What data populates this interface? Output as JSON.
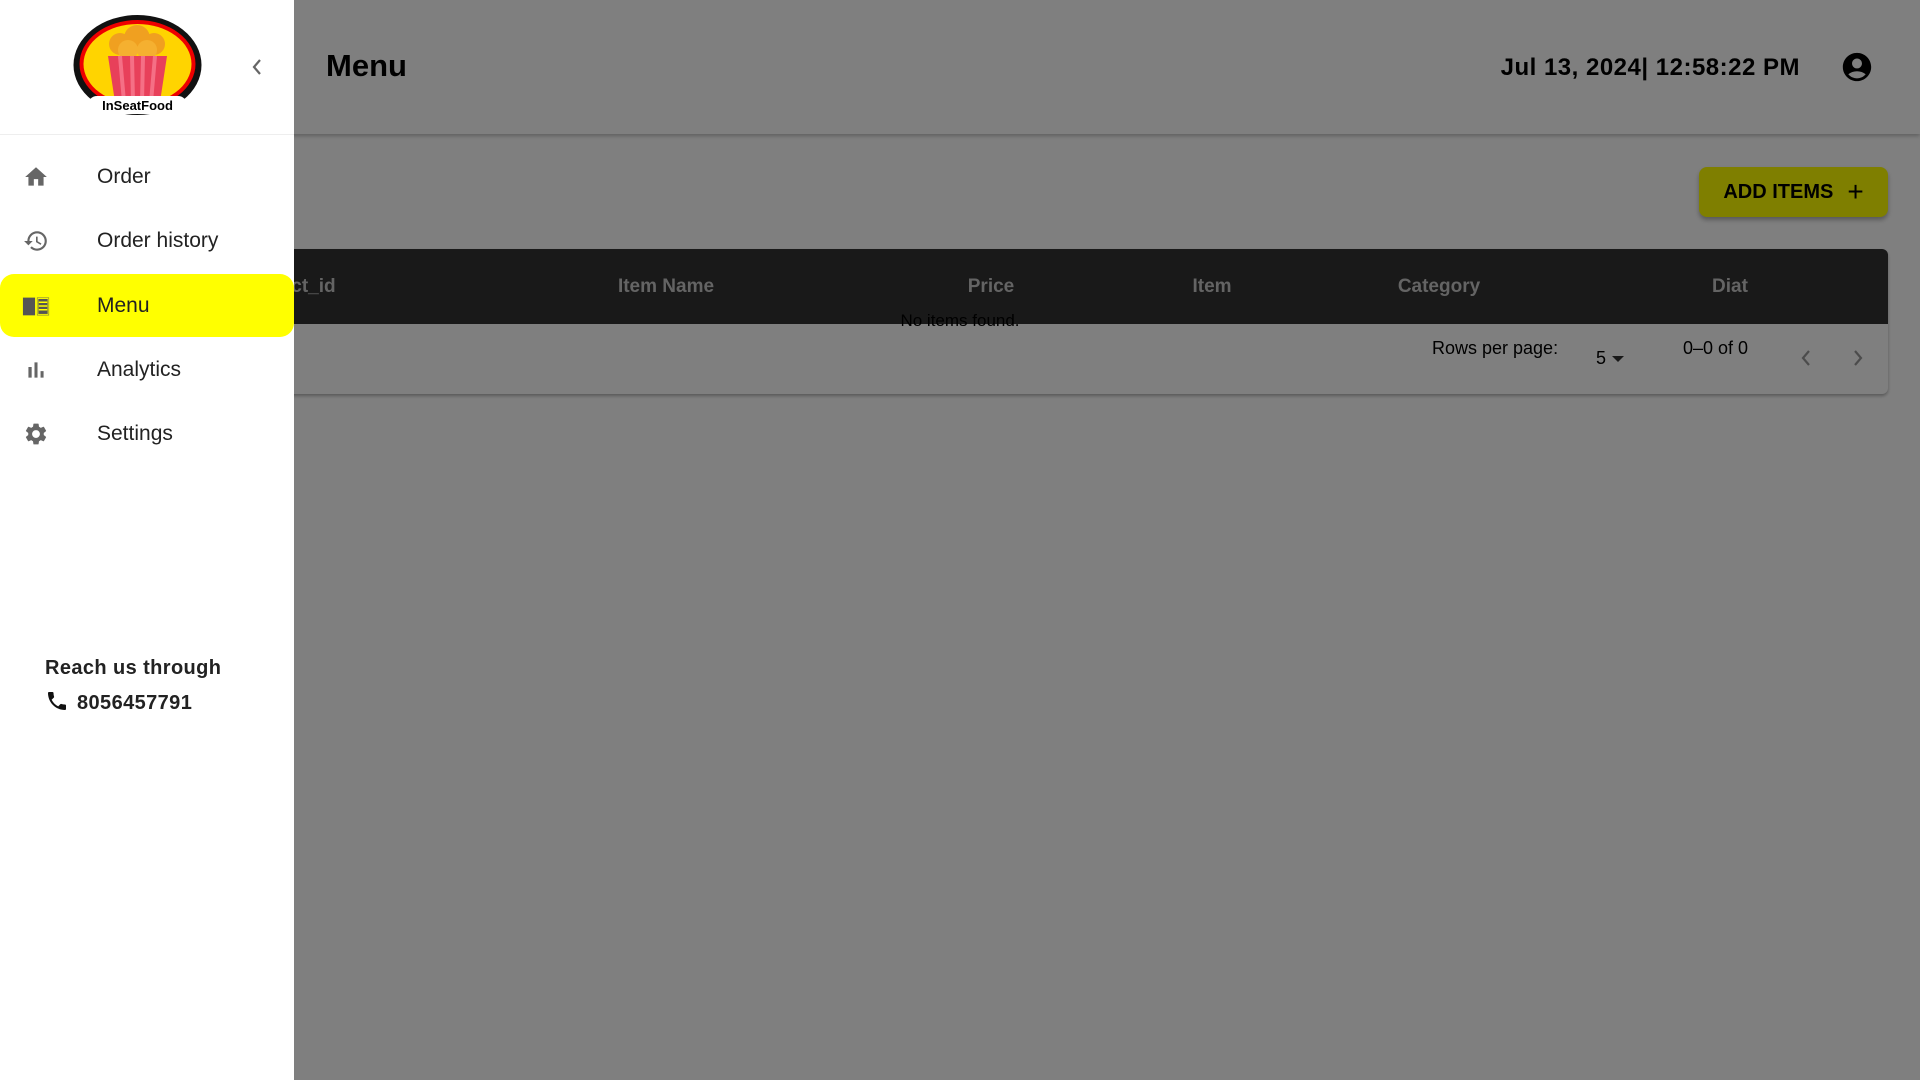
{
  "header": {
    "title": "Menu",
    "datetime": "Jul 13, 2024| 12:58:22 PM",
    "avatar_icon": "account-circle-icon"
  },
  "toolbar": {
    "add_items_label": "ADD ITEMS",
    "add_icon": "plus-icon"
  },
  "table": {
    "columns": [
      "Product_id",
      "Item Name",
      "Price",
      "Item",
      "Category",
      "Diat"
    ],
    "visible_first_column_text": "duct_id",
    "rows": [],
    "empty_message": "No items found.",
    "pagination": {
      "rows_per_page_label": "Rows per page:",
      "rows_per_page_value": "5",
      "range": "0–0 of 0",
      "prev_icon": "chevron-left-icon",
      "next_icon": "chevron-right-icon"
    }
  },
  "sidebar": {
    "logo_text": "InSeatFood",
    "collapse_icon": "chevron-left-icon",
    "items": [
      {
        "label": "Order",
        "icon": "home-icon",
        "active": false
      },
      {
        "label": "Order history",
        "icon": "history-icon",
        "active": false
      },
      {
        "label": "Menu",
        "icon": "menu-book-icon",
        "active": true
      },
      {
        "label": "Analytics",
        "icon": "bar-chart-icon",
        "active": false
      },
      {
        "label": "Settings",
        "icon": "gear-icon",
        "active": false
      }
    ],
    "contact": {
      "heading": "Reach us through",
      "phone_icon": "phone-icon",
      "phone": "8056457791"
    }
  },
  "colors": {
    "accent": "#ffff00",
    "table_header": "#333333",
    "overlay": "rgba(0,0,0,0.5)"
  }
}
